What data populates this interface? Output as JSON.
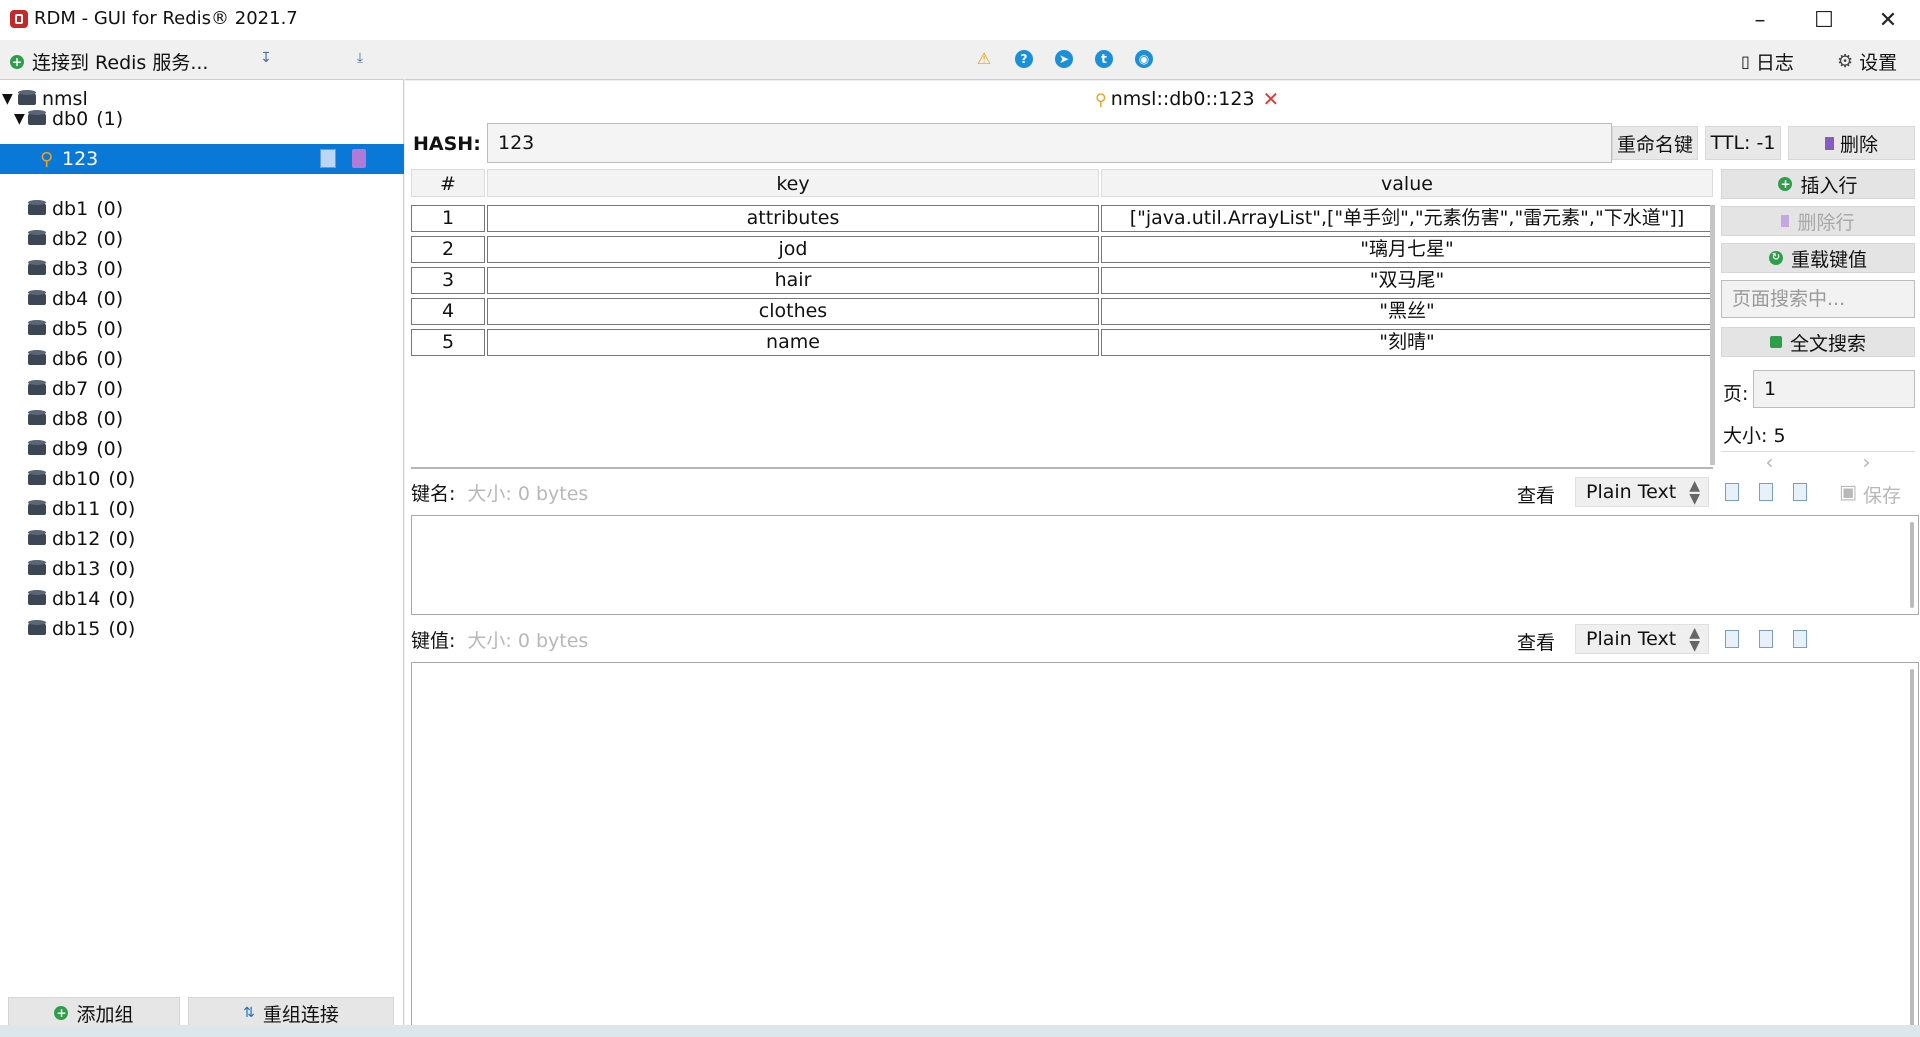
{
  "window": {
    "title": "RDM - GUI for Redis® 2021.7"
  },
  "sidebar": {
    "connect_label": "连接到 Redis 服务...",
    "server": "nmsl",
    "databases": [
      {
        "label": "db0",
        "count": "(1)"
      },
      {
        "label": "db1",
        "count": "(0)"
      },
      {
        "label": "db2",
        "count": "(0)"
      },
      {
        "label": "db3",
        "count": "(0)"
      },
      {
        "label": "db4",
        "count": "(0)"
      },
      {
        "label": "db5",
        "count": "(0)"
      },
      {
        "label": "db6",
        "count": "(0)"
      },
      {
        "label": "db7",
        "count": "(0)"
      },
      {
        "label": "db8",
        "count": "(0)"
      },
      {
        "label": "db9",
        "count": "(0)"
      },
      {
        "label": "db10",
        "count": "(0)"
      },
      {
        "label": "db11",
        "count": "(0)"
      },
      {
        "label": "db12",
        "count": "(0)"
      },
      {
        "label": "db13",
        "count": "(0)"
      },
      {
        "label": "db14",
        "count": "(0)"
      },
      {
        "label": "db15",
        "count": "(0)"
      }
    ],
    "selected_key": "123",
    "add_group": "添加组",
    "reconnect": "重组连接"
  },
  "toolbar": {
    "log": "日志",
    "settings": "设置"
  },
  "tab": {
    "title": "nmsl::db0::123"
  },
  "key": {
    "type_label": "HASH:",
    "name": "123",
    "rename": "重命名键",
    "ttl": "TTL:  -1",
    "delete": "删除"
  },
  "table": {
    "columns": [
      "#",
      "key",
      "value"
    ],
    "rows": [
      {
        "n": "1",
        "key": "attributes",
        "value": "[\"java.util.ArrayList\",[\"单手剑\",\"元素伤害\",\"雷元素\",\"下水道\"]]"
      },
      {
        "n": "2",
        "key": "jod",
        "value": "\"璃月七星\""
      },
      {
        "n": "3",
        "key": "hair",
        "value": "\"双马尾\""
      },
      {
        "n": "4",
        "key": "clothes",
        "value": "\"黑丝\""
      },
      {
        "n": "5",
        "key": "name",
        "value": "\"刻晴\""
      }
    ]
  },
  "side": {
    "insert_row": "插入行",
    "delete_row": "删除行",
    "reload": "重载键值",
    "search_placeholder": "页面搜索中...",
    "fulltext": "全文搜索",
    "page_label": "页:",
    "page_value": "1",
    "size_label": "大小:  5"
  },
  "editor": {
    "keyname_label": "键名:",
    "keyname_size": "大小:  0 bytes",
    "value_label": "键值:",
    "value_size": "大小:  0 bytes",
    "view_label": "查看",
    "view_format": "Plain Text",
    "save": "保存"
  },
  "colors": {
    "selection": "#0a78d7",
    "accent": "#1c8fd9",
    "danger": "#e53935"
  }
}
